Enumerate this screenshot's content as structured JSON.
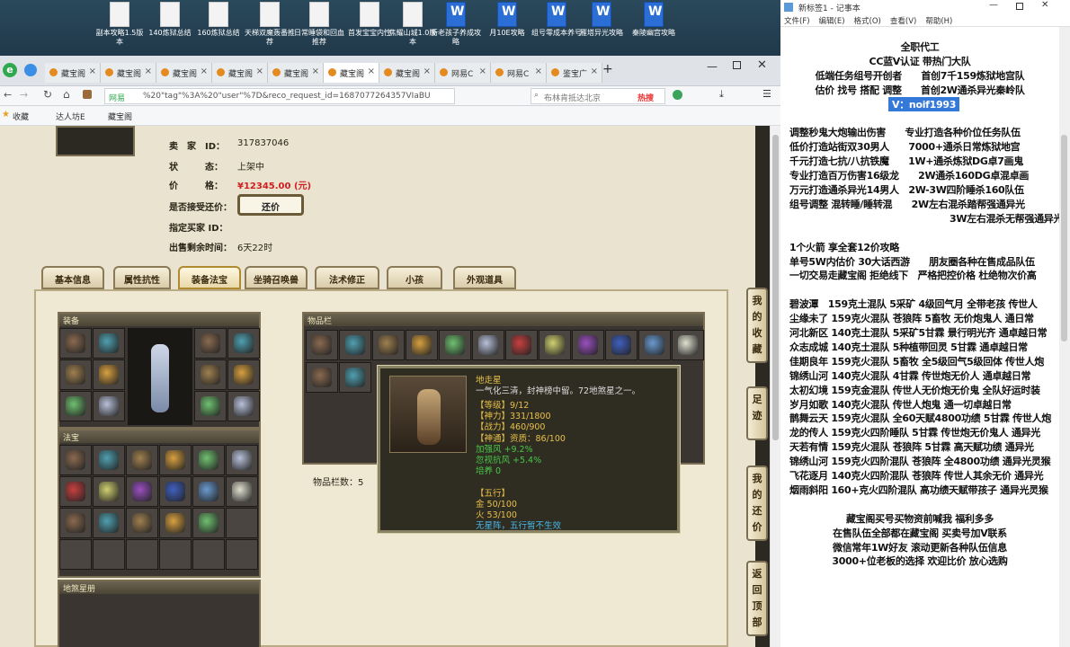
{
  "desktop": {
    "icons": [
      {
        "label": "副本攻略1.5版本",
        "type": "doc"
      },
      {
        "label": "140炼狱总结",
        "type": "doc"
      },
      {
        "label": "160炼狱总结",
        "type": "doc"
      },
      {
        "label": "天梯双魔轰番推荐",
        "type": "doc"
      },
      {
        "label": "日常睡袋和回血推荐",
        "type": "doc"
      },
      {
        "label": "首发宝宝内性",
        "type": "doc"
      },
      {
        "label": "焦耀山城1.0版本",
        "type": "doc"
      },
      {
        "label": "新老孩子养成攻略",
        "type": "word"
      },
      {
        "label": "月10E攻略",
        "type": "word"
      },
      {
        "label": "组号零成本养号",
        "type": "word"
      },
      {
        "label": "雁塔异光攻略",
        "type": "word"
      },
      {
        "label": "秦陵幽宫攻略",
        "type": "word"
      }
    ]
  },
  "browser": {
    "tabs": [
      "藏宝阁",
      "藏宝阁",
      "藏宝阁",
      "藏宝阁",
      "藏宝阁",
      "藏宝阁",
      "藏宝阁",
      "网易C",
      "网易C",
      "鉴宝广"
    ],
    "active_tab": 5,
    "url": "%20\"tag\"%3A%20\"user\"%7D&reco_request_id=1687077264357VIaBU",
    "site": "网易",
    "search_placeholder": "布林肯抵达北京",
    "hot_label": "热搜",
    "bookmarks": [
      "收藏",
      "达人坊E",
      "藏宝阁"
    ]
  },
  "item": {
    "seller_label": "卖　家　ID：",
    "seller_id": "317837046",
    "status_label": "状　　　态：",
    "status": "上架中",
    "price_label": "价　　　格：",
    "price": "¥12345.00 (元)",
    "bargain_label": "是否接受还价：",
    "bargain_button": "还价",
    "buyer_label": "指定买家 ID：",
    "time_label": "出售剩余时间：",
    "time_left": "6天22时"
  },
  "tabs": [
    "基本信息",
    "属性抗性",
    "装备法宝",
    "坐骑召唤兽",
    "法术修正",
    "小孩",
    "外观道具"
  ],
  "active_tab": 2,
  "sections": {
    "equip": "装备",
    "treasure": "法宝",
    "bag": "物品栏",
    "bag_count": "物品栏数：5",
    "book": "地煞星册"
  },
  "side_buttons": [
    "我的收藏",
    "足迹",
    "我的还价",
    "返回顶部"
  ],
  "tooltip": {
    "name": "地走星",
    "desc": "一气化三清，封神榜中留。72地煞星之一。",
    "lines": [
      {
        "text": "【等级】9/12",
        "color": "#e8c048"
      },
      {
        "text": "【神力】331/1800",
        "color": "#e8c048"
      },
      {
        "text": "【战力】460/900",
        "color": "#e8c048"
      },
      {
        "text": "【神通】资质：86/100",
        "color": "#e8c048"
      },
      {
        "text": "加强风 +9.2%",
        "color": "#48c848"
      },
      {
        "text": "忽视抗风 +5.4%",
        "color": "#48c848"
      },
      {
        "text": "培养 0",
        "color": "#48c848"
      },
      {
        "text": "",
        "color": "#fff"
      },
      {
        "text": "【五行】",
        "color": "#e8c048"
      },
      {
        "text": "金 50/100",
        "color": "#e8c048"
      },
      {
        "text": "火 53/100",
        "color": "#e8c048"
      },
      {
        "text": "无星阵，五行暂不生效",
        "color": "#48b8e8"
      }
    ]
  },
  "notepad": {
    "title": "新标签1 - 记事本",
    "menu": [
      "文件(F)",
      "编辑(E)",
      "格式(O)",
      "查看(V)",
      "帮助(H)"
    ],
    "lines": [
      "全职代工",
      "CC蓝V认证 带热门大队",
      "低端任务组号开创者　　首创7千159炼狱地宫队",
      "估价 找号 搭配 调整　　首创2W通杀异光秦岭队",
      "V：noif1993",
      "",
      "调整秒鬼大炮输出伤害　　专业打造各种价位任务队伍",
      "低价打造站街双30男人　　7000+通杀日常炼狱地宫",
      "千元打造七抗/八抗铁魔　　1W+通杀炼狱DG卓7画鬼",
      "专业打造百万伤害16级龙　　2W通杀160DG卓混卓画",
      "万元打造通杀异光14男人　2W-3W四阶睡杀160队伍",
      "组号调整 混转睡/睡转混　　2W左右混杀踏帮强通异光",
      "3W左右混杀无帮强通异光",
      "",
      "1个火箭 享全套12价攻略",
      "单号5W内估价 30大话西游　　朋友圈各种在售成品队伍",
      "一切交易走藏宝阁 拒绝线下　严格把控价格 杜绝物次价高",
      "",
      "碧波潭　159克土混队 5采矿 4级回气月 全带老孩 传世人",
      "尘缘未了 159克火混队 苍狼阵 5畜牧 无价炮鬼人 通日常",
      "河北新区 140克土混队 5采矿5甘霖 景行明光齐 通卓越日常",
      "众志成城 140克土混队 5种植带回灵 5甘霖 通卓越日常",
      "佳期良年 159克火混队 5畜牧 全5级回气5级回体 传世人炮",
      "锦绣山河 140克火混队 4甘霖 传世炮无价人 通卓越日常",
      "太初幻境 159克金混队 传世人无价炮无价鬼 全队好运时装",
      "岁月如歌 140克火混队 传世人炮鬼 通一切卓越日常",
      "鹊舞云天 159克火混队 全60天赋4800功绩 5甘霖 传世人炮",
      "龙的传人 159克火四阶睡队 5甘霖 传世炮无价鬼人 通异光",
      "天若有情 159克火混队 苍狼阵 5甘霖 高天赋功绩 通异光",
      "锦绣山河 159克火四阶混队 苍狼阵 全4800功绩 通异光灵猴",
      "飞花逐月 140克火四阶混队 苍狼阵 传世人其余无价 通异光",
      "烟雨斜阳 160+克火四阶混队 高功绩天赋带孩子 通异光灵猴",
      "",
      "藏宝阁买号买物资前喊我 福利多多",
      "在售队伍全部都在藏宝阁 买卖号加V联系",
      "微信常年1W好友 滚动更新各种队伍信息",
      "3000+位老板的选择 欢迎比价 放心选购"
    ]
  }
}
